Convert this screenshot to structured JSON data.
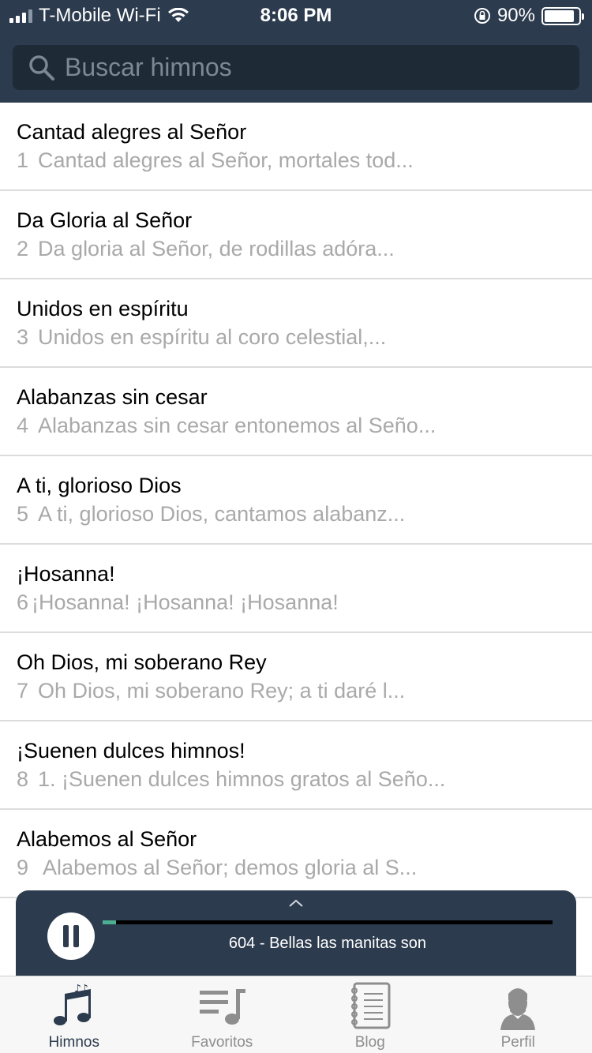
{
  "status_bar": {
    "carrier": "T-Mobile Wi-Fi",
    "time": "8:06 PM",
    "battery": "90%"
  },
  "search": {
    "placeholder": "Buscar himnos"
  },
  "hymns": [
    {
      "title": "Cantad alegres al Señor",
      "number": "1",
      "preview": "Cantad alegres al Señor, mortales tod..."
    },
    {
      "title": "Da Gloria al Señor",
      "number": "2",
      "preview": "Da gloria al Señor, de rodillas adóra..."
    },
    {
      "title": "Unidos en espíritu",
      "number": "3",
      "preview": "Unidos en espíritu al coro celestial,..."
    },
    {
      "title": "Alabanzas sin cesar",
      "number": "4",
      "preview": "Alabanzas sin cesar entonemos al Seño..."
    },
    {
      "title": "A ti, glorioso Dios",
      "number": "5",
      "preview": "A ti, glorioso Dios, cantamos alabanz..."
    },
    {
      "title": "¡Hosanna!",
      "number": "6",
      "preview": "¡Hosanna! ¡Hosanna! ¡Hosanna!"
    },
    {
      "title": "Oh Dios, mi soberano Rey",
      "number": "7",
      "preview": "Oh Dios, mi soberano Rey; a ti daré l..."
    },
    {
      "title": "¡Suenen dulces himnos!",
      "number": "8",
      "preview": "1. ¡Suenen dulces himnos gratos al Seño..."
    },
    {
      "title": "Alabemos al Señor",
      "number": "9",
      "preview": " Alabemos al Señor; demos gloria al S..."
    }
  ],
  "player": {
    "now_playing": "604 - Bellas las manitas son",
    "progress": 0.03
  },
  "tabs": [
    {
      "label": "Himnos",
      "icon": "music-notes-icon",
      "active": true
    },
    {
      "label": "Favoritos",
      "icon": "playlist-icon",
      "active": false
    },
    {
      "label": "Blog",
      "icon": "notebook-icon",
      "active": false
    },
    {
      "label": "Perfil",
      "icon": "bearded-person-icon",
      "active": false
    }
  ],
  "colors": {
    "header": "#2c3b4e",
    "search_bg": "#1f2a37",
    "progress": "#4caf93"
  }
}
